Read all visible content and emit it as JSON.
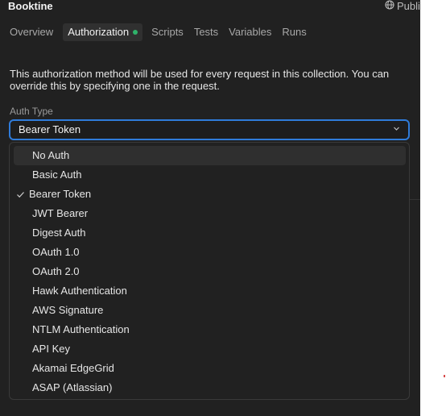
{
  "header": {
    "collection_name": "Booktine",
    "publish_label": "Publi",
    "publish_icon": "globe-icon"
  },
  "tabs": [
    {
      "label": "Overview",
      "active": false
    },
    {
      "label": "Authorization",
      "active": true,
      "indicator_color": "#2fb26a"
    },
    {
      "label": "Scripts",
      "active": false
    },
    {
      "label": "Tests",
      "active": false
    },
    {
      "label": "Variables",
      "active": false
    },
    {
      "label": "Runs",
      "active": false
    }
  ],
  "auth": {
    "description": "This authorization method will be used for every request in this collection. You can override this by specifying one in the request.",
    "type_label": "Auth Type",
    "selected": "Bearer Token",
    "chevron_icon": "chevron-down-icon",
    "options": [
      "No Auth",
      "Basic Auth",
      "Bearer Token",
      "JWT Bearer",
      "Digest Auth",
      "OAuth 1.0",
      "OAuth 2.0",
      "Hawk Authentication",
      "AWS Signature",
      "NTLM Authentication",
      "API Key",
      "Akamai EdgeGrid",
      "ASAP (Atlassian)"
    ],
    "hovered": "No Auth",
    "check_icon": "check-icon"
  },
  "colors": {
    "focus_border": "#2f7bd9",
    "panel_bg": "#212121"
  }
}
